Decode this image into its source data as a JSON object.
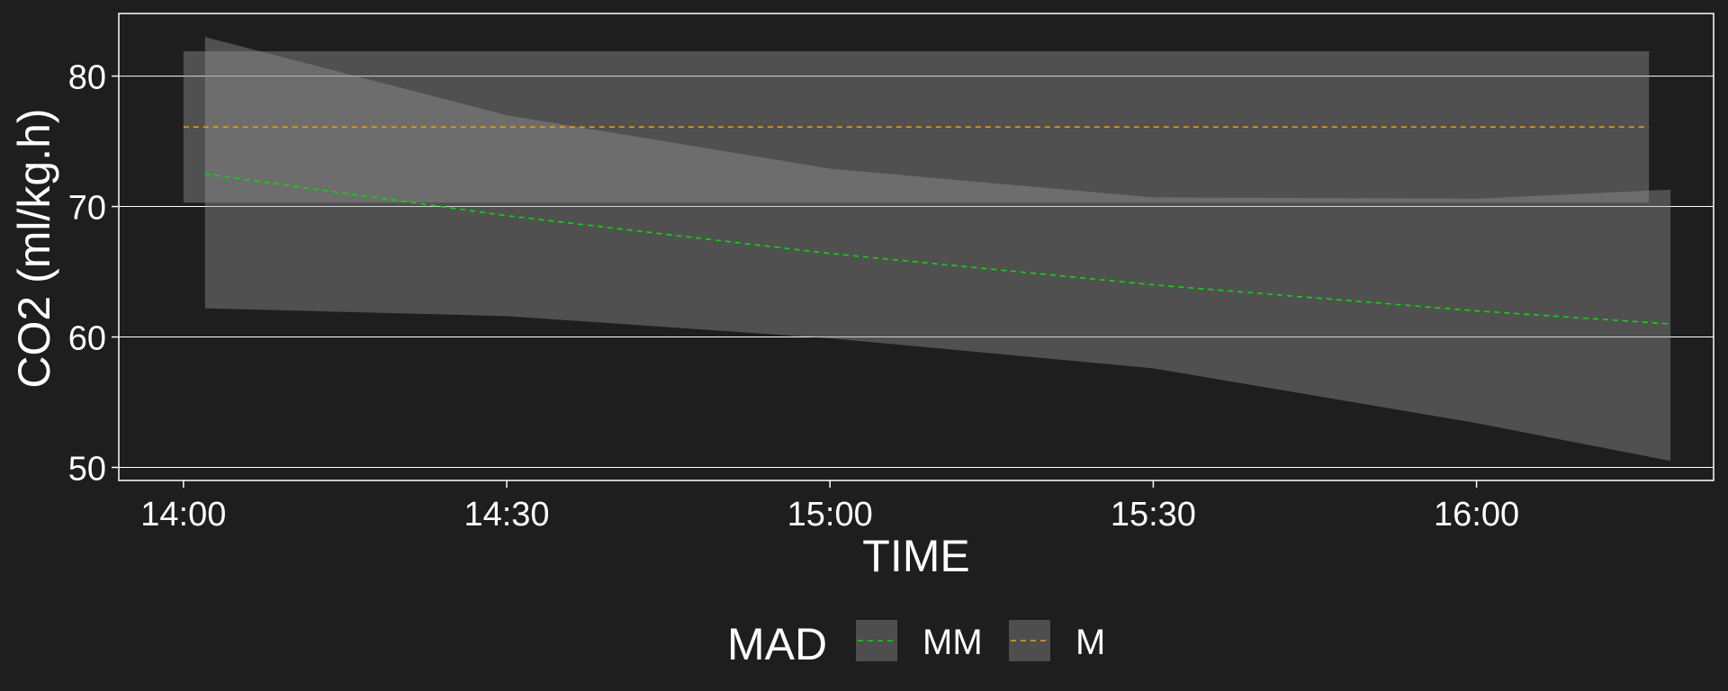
{
  "chart_data": {
    "type": "line",
    "xlabel": "TIME",
    "ylabel": "CO2 (ml/kg.h)",
    "xlim": [
      "13:54",
      "16:22"
    ],
    "ylim": [
      49,
      84.8
    ],
    "x_ticks": [
      "14:00",
      "14:30",
      "15:00",
      "15:30",
      "16:00"
    ],
    "y_ticks": [
      50,
      60,
      70,
      80
    ],
    "grid": "horizontal",
    "legend": {
      "title": "MAD",
      "position": "bottom",
      "entries": [
        {
          "label": "MM",
          "color": "#00e000"
        },
        {
          "label": "M",
          "color": "#f0a000"
        }
      ]
    },
    "series": [
      {
        "name": "MM",
        "color": "#00e000",
        "line_style": "dashed",
        "x": [
          "14:02",
          "14:30",
          "15:00",
          "15:30",
          "16:00",
          "16:18"
        ],
        "y": [
          72.5,
          69.3,
          66.4,
          64.0,
          62.0,
          61.0
        ],
        "ribbon_lower": [
          62.2,
          61.6,
          59.9,
          57.6,
          53.4,
          50.5
        ],
        "ribbon_upper": [
          83.0,
          77.0,
          72.9,
          70.7,
          70.6,
          71.3
        ]
      },
      {
        "name": "M",
        "color": "#f0a000",
        "line_style": "dashed",
        "x": [
          "14:00",
          "16:16"
        ],
        "y": [
          76.1,
          76.1
        ],
        "ribbon_lower": [
          70.3,
          70.3
        ],
        "ribbon_upper": [
          81.9,
          81.9
        ]
      }
    ]
  }
}
